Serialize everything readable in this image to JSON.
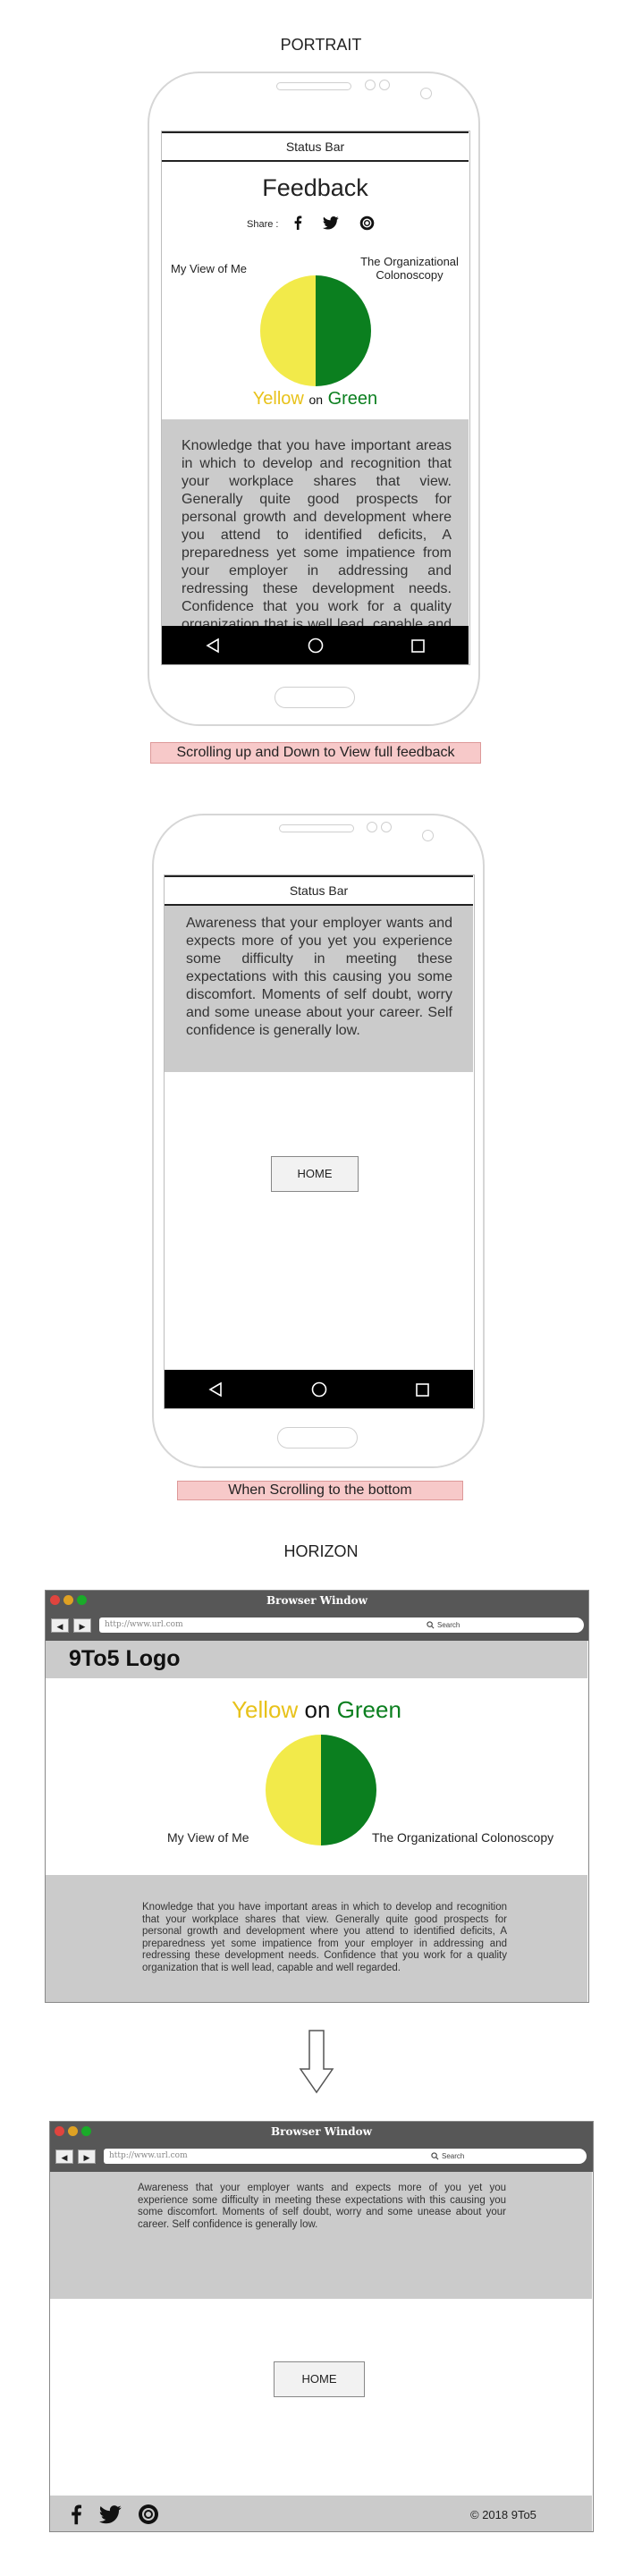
{
  "portrait_title": "PORTRAIT",
  "horizon_title": "HORIZON",
  "phone1": {
    "status_bar": "Status Bar",
    "heading": "Feedback",
    "share_label": "Share :",
    "left_label": "My View of Me",
    "right_label": "The Organizational Colonoscopy",
    "color_yellow": "Yellow",
    "color_on": "on",
    "color_green": "Green",
    "feedback_text": "Knowledge that you have important areas in which to develop and recognition that your workplace shares that view. Generally quite good prospects for personal growth and development where you attend to identified deficits, A preparedness yet some impatience from your employer in addressing and redressing these development needs. Confidence that you work for a quality organization that is well lead, capable and well regarded."
  },
  "caption1": "Scrolling up and Down to View full feedback",
  "phone2": {
    "status_bar": "Status Bar",
    "feedback_text": "Awareness that your employer wants and expects more of you yet you experience some difficulty in meeting these expectations with this causing you some discomfort. Moments of self doubt, worry and some unease about your career. Self confidence is generally low.",
    "home_button": "HOME"
  },
  "caption2": "When Scrolling to the bottom",
  "browser1": {
    "window_title": "Browser Window",
    "url": "http://www.url.com",
    "search": "Search",
    "logo": "9To5 Logo",
    "color_yellow": "Yellow",
    "color_on": "on",
    "color_green": "Green",
    "left_label": "My View of Me",
    "right_label": "The Organizational Colonoscopy",
    "feedback_text": "Knowledge that you have important areas in which to develop and recognition that your workplace shares that view. Generally quite good prospects for personal growth and development where you attend to identified deficits, A preparedness yet some impatience from your employer in addressing and redressing these development needs. Confidence that you work for a quality organization that is well lead, capable and well regarded."
  },
  "browser2": {
    "window_title": "Browser Window",
    "url": "http://www.url.com",
    "search": "Search",
    "feedback_text": "Awareness that your employer wants and expects more of you yet you experience some difficulty in meeting these expectations with this causing you some discomfort. Moments of self doubt, worry and some unease about your career. Self confidence is generally low.",
    "home_button": "HOME",
    "copyright": "© 2018 9To5"
  },
  "icons": [
    "facebook-icon",
    "twitter-icon",
    "instagram-icon",
    "back-icon",
    "home-circle-icon",
    "recents-icon",
    "arrow-down-icon"
  ],
  "colors": {
    "yellow": "#f2ea4a",
    "green": "#0b7f1f",
    "yellow_text": "#e8c21a",
    "grey_panel": "#cbcbcb"
  }
}
